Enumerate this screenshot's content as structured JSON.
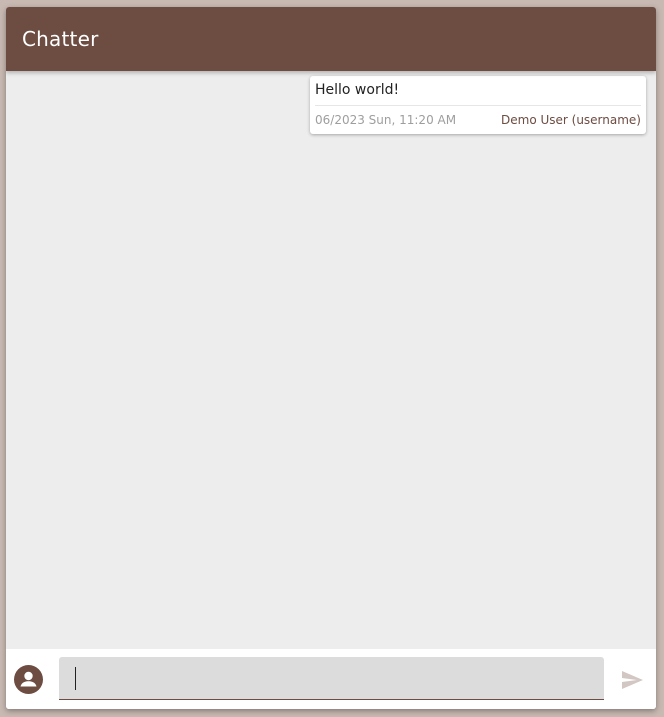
{
  "app": {
    "title": "Chatter"
  },
  "messages": [
    {
      "text": "Hello world!",
      "timestamp": "06/2023 Sun, 11:20 AM",
      "author": "Demo User (username)"
    }
  ],
  "composer": {
    "input_value": "",
    "placeholder": "",
    "avatar_icon": "account-circle-icon",
    "send_icon": "send-icon"
  },
  "colors": {
    "primary": "#6d4c41",
    "background": "#ededed",
    "send_disabled": "#d3c7c3"
  }
}
